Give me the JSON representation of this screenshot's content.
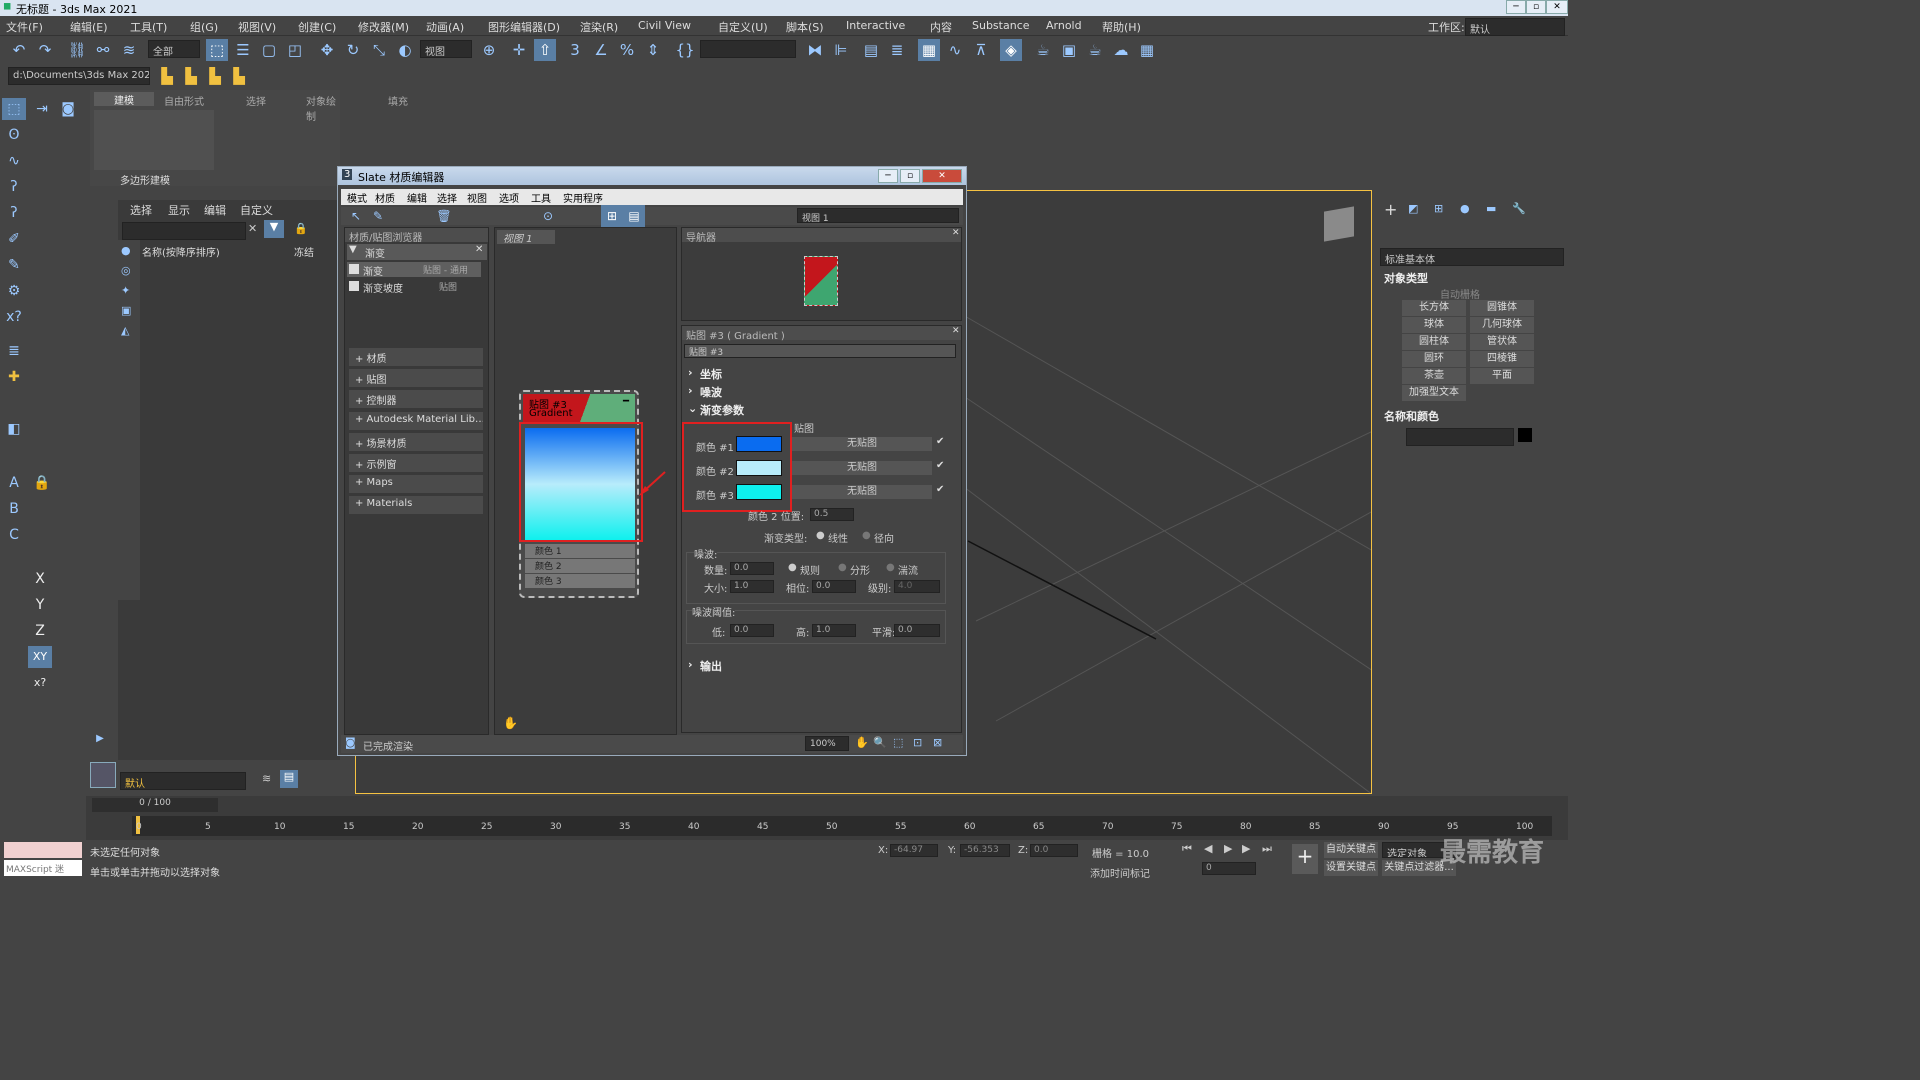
{
  "window": {
    "title": "无标题 - 3ds Max 2021"
  },
  "menu": [
    "文件(F)",
    "编辑(E)",
    "工具(T)",
    "组(G)",
    "视图(V)",
    "创建(C)",
    "修改器(M)",
    "动画(A)",
    "图形编辑器(D)",
    "渲染(R)",
    "Civil View",
    "自定义(U)",
    "脚本(S)",
    "Interactive",
    "内容",
    "Substance",
    "Arnold",
    "帮助(H)"
  ],
  "workspace": {
    "label": "工作区:",
    "value": "默认"
  },
  "toolbar": {
    "filter": "全部",
    "refcoord": "视图",
    "path": "d:\\Documents\\3ds Max 2021"
  },
  "ribbon": {
    "tabs": [
      "建模",
      "自由形式",
      "选择",
      "对象绘制",
      "填充"
    ],
    "group": "多边形建模"
  },
  "scene_explorer": {
    "tabs": [
      "选择",
      "显示",
      "编辑",
      "自定义"
    ],
    "col_name": "名称(按降序排序)",
    "col_frozen": "冻结"
  },
  "slate": {
    "title": "Slate 材质编辑器",
    "menu": [
      "模式",
      "材质",
      "编辑",
      "选择",
      "视图",
      "选项",
      "工具",
      "实用程序"
    ],
    "view_combo": "视图 1",
    "browser": {
      "title": "材质/贴图浏览器",
      "search": "渐变",
      "results": [
        {
          "name": "渐变",
          "type": "贴图 - 通用"
        },
        {
          "name": "渐变坡度",
          "type": "贴图"
        }
      ],
      "groups": [
        "+ 材质",
        "+ 贴图",
        "+ 控制器",
        "+ Autodesk Material Lib…",
        "+ 场景材质",
        "+ 示例窗",
        "+ Maps",
        "+ Materials"
      ]
    },
    "view_tab": "视图 1",
    "node": {
      "title": "贴图 #3",
      "subtitle": "Gradient",
      "ports": [
        "颜色 1",
        "颜色 2",
        "颜色 3"
      ]
    },
    "navigator": {
      "title": "导航器"
    },
    "params": {
      "header": "贴图 #3 ( Gradient )",
      "name": "贴图 #3",
      "rollouts": [
        "坐标",
        "噪波",
        "渐变参数",
        "输出"
      ],
      "map_label": "贴图",
      "colors": [
        {
          "label": "颜色 #1",
          "color": "#0a6cf0",
          "map": "无贴图"
        },
        {
          "label": "颜色 #2",
          "color": "#b8ecfb",
          "map": "无贴图"
        },
        {
          "label": "颜色 #3",
          "color": "#0ef0ee",
          "map": "无贴图"
        }
      ],
      "color2pos_label": "颜色 2 位置:",
      "color2pos": "0.5",
      "gradtype_label": "渐变类型:",
      "gradtype": [
        "线性",
        "径向"
      ],
      "noise_label": "噪波:",
      "amount_label": "数量:",
      "amount": "0.0",
      "noise_types": [
        "规则",
        "分形",
        "湍流"
      ],
      "size_label": "大小:",
      "size": "1.0",
      "phase_label": "相位:",
      "phase": "0.0",
      "levels_label": "级别:",
      "levels": "4.0",
      "threshold_label": "噪波阈值:",
      "low_label": "低:",
      "low": "0.0",
      "high_label": "高:",
      "high": "1.0",
      "smooth_label": "平滑:",
      "smooth": "0.0"
    },
    "status": "已完成渲染",
    "zoom": "100%"
  },
  "cmd": {
    "category": "标准基本体",
    "objtype": "对象类型",
    "autogrid": "自动栅格",
    "buttons": [
      "长方体",
      "圆锥体",
      "球体",
      "几何球体",
      "圆柱体",
      "管状体",
      "圆环",
      "四棱锥",
      "茶壶",
      "平面",
      "加强型文本"
    ],
    "namecolor": "名称和颜色"
  },
  "layer": "默认",
  "timeline": {
    "frame": "0 / 100",
    "ticks": [
      "0",
      "5",
      "10",
      "15",
      "20",
      "25",
      "30",
      "35",
      "40",
      "45",
      "50",
      "55",
      "60",
      "65",
      "70",
      "75",
      "80",
      "85",
      "90",
      "95",
      "100"
    ]
  },
  "status": {
    "line1": "未选定任何对象",
    "line2": "单击或单击并拖动以选择对象",
    "maxscript": "MAXScript 迷",
    "x": "-64.97",
    "y": "-56.353",
    "z": "0.0",
    "grid": "栅格 = 10.0",
    "addtime": "添加时间标记",
    "autokey": "自动关键点",
    "setkey": "设置关键点",
    "selobj": "选定对象",
    "keyfilter": "关键点过滤器...",
    "frame": "0"
  },
  "watermark": "最需教育"
}
